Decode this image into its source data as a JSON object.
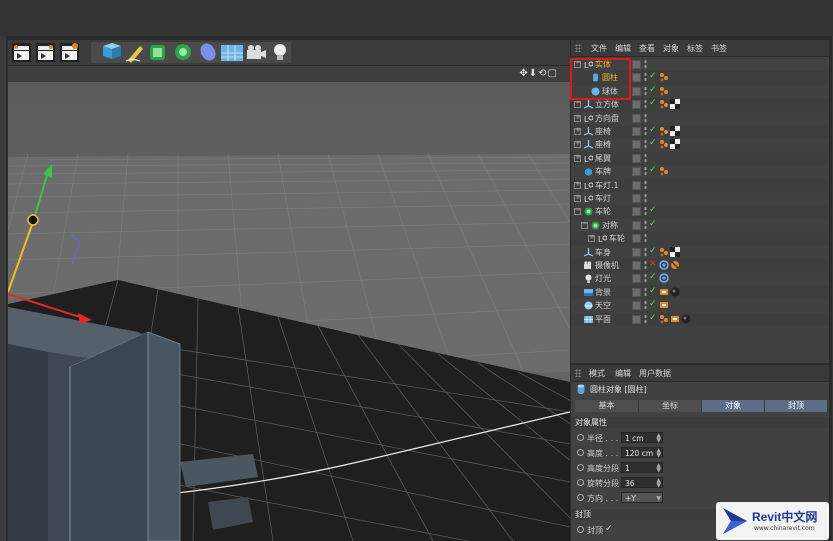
{
  "object_manager": {
    "menu": [
      "文件",
      "编辑",
      "查看",
      "对象",
      "标签",
      "书签"
    ],
    "rows": [
      {
        "name": "实体",
        "depth": 0,
        "type": "null",
        "expand": "-",
        "highlight": true,
        "tags": []
      },
      {
        "name": "圆柱",
        "depth": 1,
        "type": "cylinder",
        "expand": "",
        "highlight": true,
        "tags": [
          "phong"
        ]
      },
      {
        "name": "球体",
        "depth": 1,
        "type": "sphere",
        "expand": "",
        "highlight": false,
        "tags": [
          "phong"
        ]
      },
      {
        "name": "立方体",
        "depth": 0,
        "type": "joint",
        "expand": "-",
        "highlight": false,
        "tags": [
          "phong",
          "checker"
        ]
      },
      {
        "name": "方向盘",
        "depth": 0,
        "type": "null",
        "expand": "+",
        "highlight": false,
        "tags": []
      },
      {
        "name": "座椅",
        "depth": 0,
        "type": "joint",
        "expand": "+",
        "highlight": false,
        "tags": [
          "phong",
          "checker"
        ]
      },
      {
        "name": "座椅",
        "depth": 0,
        "type": "joint",
        "expand": "+",
        "highlight": false,
        "tags": [
          "phong",
          "checker"
        ]
      },
      {
        "name": "尾翼",
        "depth": 0,
        "type": "null",
        "expand": "+",
        "highlight": false,
        "tags": []
      },
      {
        "name": "车牌",
        "depth": 0,
        "type": "cube",
        "expand": "",
        "highlight": false,
        "tags": [
          "phong"
        ]
      },
      {
        "name": "车灯.1",
        "depth": 0,
        "type": "null",
        "expand": "+",
        "highlight": false,
        "tags": []
      },
      {
        "name": "车灯",
        "depth": 0,
        "type": "null",
        "expand": "+",
        "highlight": false,
        "tags": []
      },
      {
        "name": "车轮",
        "depth": 0,
        "type": "green",
        "expand": "-",
        "highlight": false,
        "tags": []
      },
      {
        "name": "对称",
        "depth": 1,
        "type": "green",
        "expand": "-",
        "highlight": false,
        "tags": []
      },
      {
        "name": "车轮",
        "depth": 2,
        "type": "null",
        "expand": "+",
        "highlight": false,
        "tags": []
      },
      {
        "name": "车身",
        "depth": 0,
        "type": "joint",
        "expand": "",
        "highlight": false,
        "tags": [
          "phong",
          "checker"
        ]
      },
      {
        "name": "摄像机",
        "depth": 0,
        "type": "camera",
        "expand": "",
        "highlight": false,
        "red": true,
        "tags": [
          "target",
          "nolight"
        ]
      },
      {
        "name": "灯光",
        "depth": 0,
        "type": "light",
        "expand": "",
        "highlight": false,
        "tags": [
          "target"
        ]
      },
      {
        "name": "背景",
        "depth": 0,
        "type": "bg",
        "expand": "",
        "highlight": false,
        "tags": [
          "comp",
          "ball"
        ]
      },
      {
        "name": "天空",
        "depth": 0,
        "type": "sky",
        "expand": "",
        "highlight": false,
        "tags": [
          "comp"
        ]
      },
      {
        "name": "平面",
        "depth": 0,
        "type": "plane",
        "expand": "",
        "highlight": false,
        "tags": [
          "phong",
          "comp",
          "ball"
        ]
      }
    ]
  },
  "attribute_manager": {
    "menu": [
      "模式",
      "编辑",
      "用户数据"
    ],
    "title": "圆柱对象 [圆柱]",
    "tabs": [
      {
        "label": "基本",
        "active": false
      },
      {
        "label": "坐标",
        "active": false
      },
      {
        "label": "对象",
        "active": true
      },
      {
        "label": "封顶",
        "active": true
      }
    ],
    "section_object": "对象属性",
    "props": [
      {
        "label": "半径 . . .",
        "value": "1 cm",
        "type": "spin"
      },
      {
        "label": "高度 . . .",
        "value": "120 cm",
        "type": "spin"
      },
      {
        "label": "高度分段",
        "value": "1",
        "type": "spin"
      },
      {
        "label": "旋转分段",
        "value": "36",
        "type": "spin"
      },
      {
        "label": "方向 . . .",
        "value": "+Y",
        "type": "dropdown"
      }
    ],
    "section_caps": "封顶",
    "caps_label": "封顶",
    "caps_check": "✓"
  },
  "viewport": {
    "nav_icons": "✥⬇⟲▢"
  },
  "watermark": {
    "brand": "Revit中文网",
    "site": "www.chinarevit.com"
  },
  "colors": {
    "highlight_border": "#e0161e",
    "active_tab": "#5b6e86",
    "check_green": "#6ad36a",
    "tag_orange": "#e08a2c"
  }
}
